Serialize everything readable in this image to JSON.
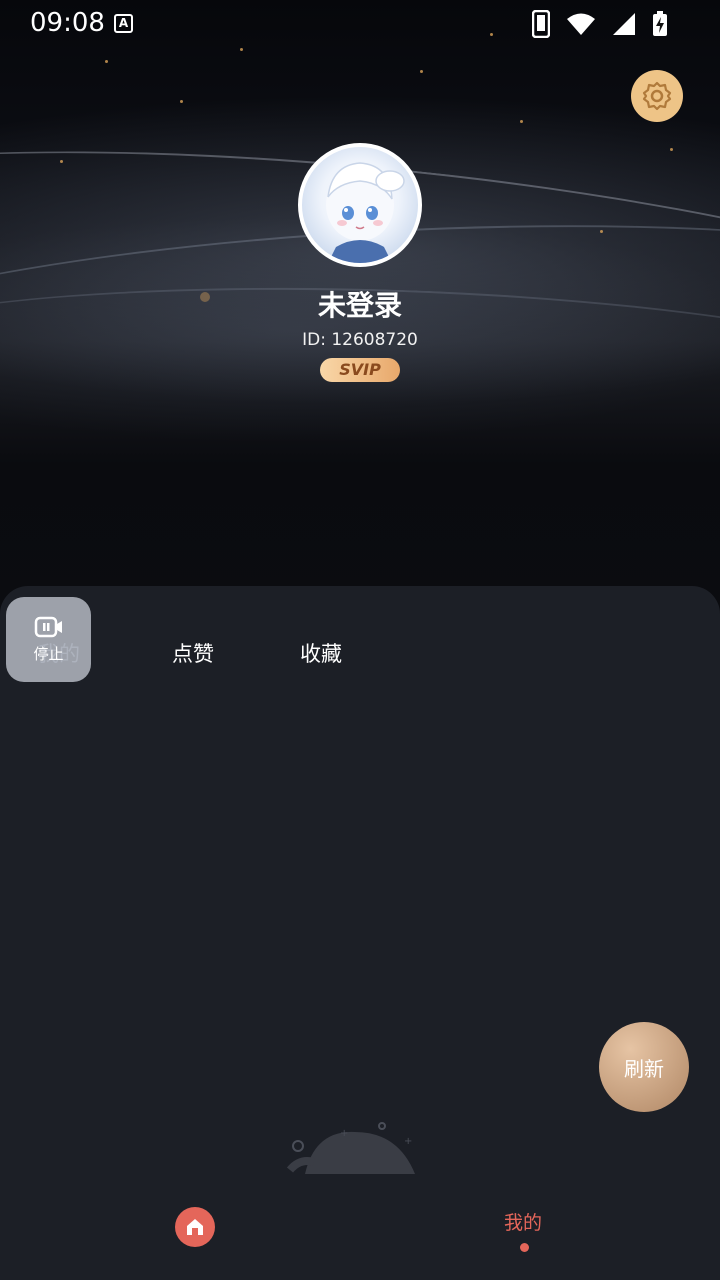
{
  "status_bar": {
    "time": "09:08",
    "notification_icon": "A",
    "icons": [
      "phone-icon",
      "wifi-icon",
      "signal-icon",
      "battery-charging-icon"
    ]
  },
  "profile": {
    "name": "未登录",
    "id_text": "ID: 12608720",
    "badge": "SVIP",
    "avatar": "anime-avatar"
  },
  "tabs": [
    {
      "label": "我的",
      "active": true
    },
    {
      "label": "点赞",
      "active": false
    },
    {
      "label": "收藏",
      "active": false
    }
  ],
  "overlay": {
    "stop_label": "停止",
    "icon": "record-stop-icon"
  },
  "refresh_label": "刷新",
  "bottom_nav": {
    "home_icon": "home-icon",
    "mine_label": "我的"
  },
  "colors": {
    "accent": "#e4665a",
    "panel": "#1c1f26",
    "gold": "#eec487"
  }
}
